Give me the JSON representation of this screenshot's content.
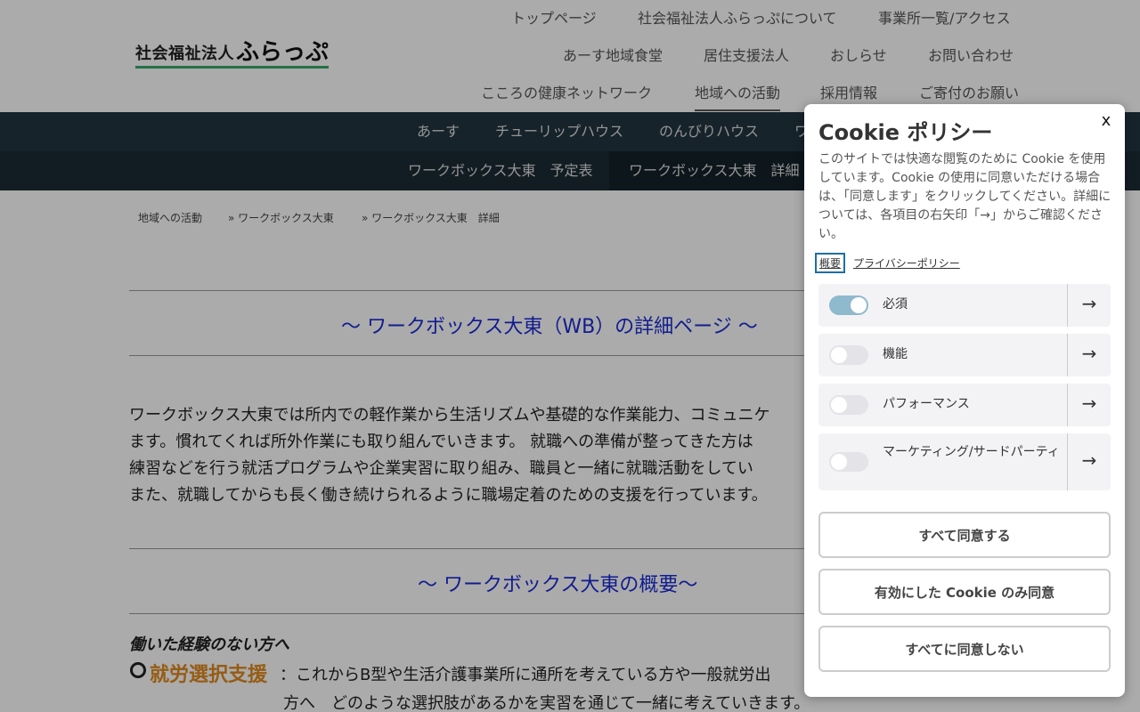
{
  "header": {
    "logo_small": "社会福祉法人",
    "logo_big": "ふらっぷ",
    "nav_row1": [
      "トップページ",
      "社会福祉法人ふらっぷについて",
      "事業所一覧/アクセス"
    ],
    "nav_row2": [
      "あーす地域食堂",
      "居住支援法人",
      "おしらせ",
      "お問い合わせ"
    ],
    "nav_row3": [
      "こころの健康ネットワーク",
      "地域への活動",
      "採用情報",
      "ご寄付のお願い"
    ],
    "active": "地域への活動"
  },
  "subnav1": [
    "あーす",
    "チューリップハウス",
    "のんびりハウス",
    "ワ"
  ],
  "subnav2": [
    "ワークボックス大東　予定表",
    "ワークボックス大東　詳細"
  ],
  "breadcrumb": [
    "地域への活動",
    "» ワークボックス大東",
    "» ワークボックス大東　詳細"
  ],
  "main": {
    "heading1": "～ ワークボックス大東（WB）の詳細ページ ～",
    "paragraph_lines": [
      "ワークボックス大東では所内での軽作業から生活リズムや基礎的な作業能力、コミュニケ",
      "ます。慣れてくれば所外作業にも取り組んでいきます。 就職への準備が整ってきた方は",
      "練習などを行う就活プログラムや企業実習に取り組み、職員と一緒に就職活動をしてい",
      "また、就職してからも長く働き続けられるように職場定着のための支援を行っています。"
    ],
    "heading2": "～ ワークボックス大東の概要～",
    "italic_heading": "働いた経験のない方へ",
    "service_label": "就労選択支援",
    "service_desc_line1": "：これからB型や生活介護事業所に通所を考えている方や一般就労出",
    "service_desc_line2": "方へ　どのような選択肢があるかを実習を通じて一緒に考えていきます。"
  },
  "cookie": {
    "title": "Cookie ポリシー",
    "close_label": "x",
    "description": "このサイトでは快適な閲覧のために Cookie を使用しています。Cookie の使用に同意いただける場合は、「同意します」をクリックしてください。詳細については、各項目の右矢印「→」からご確認ください。",
    "tabs": [
      "概要",
      "プライバシーポリシー"
    ],
    "categories": [
      {
        "label": "必須",
        "enabled": true
      },
      {
        "label": "機能",
        "enabled": false
      },
      {
        "label": "パフォーマンス",
        "enabled": false
      },
      {
        "label": "マーケティング/サードパーティ",
        "enabled": false
      }
    ],
    "arrow_glyph": "→",
    "buttons": {
      "accept_all": "すべて同意する",
      "accept_selected": "有効にした Cookie のみ同意",
      "reject_all": "すべてに同意しない"
    }
  }
}
